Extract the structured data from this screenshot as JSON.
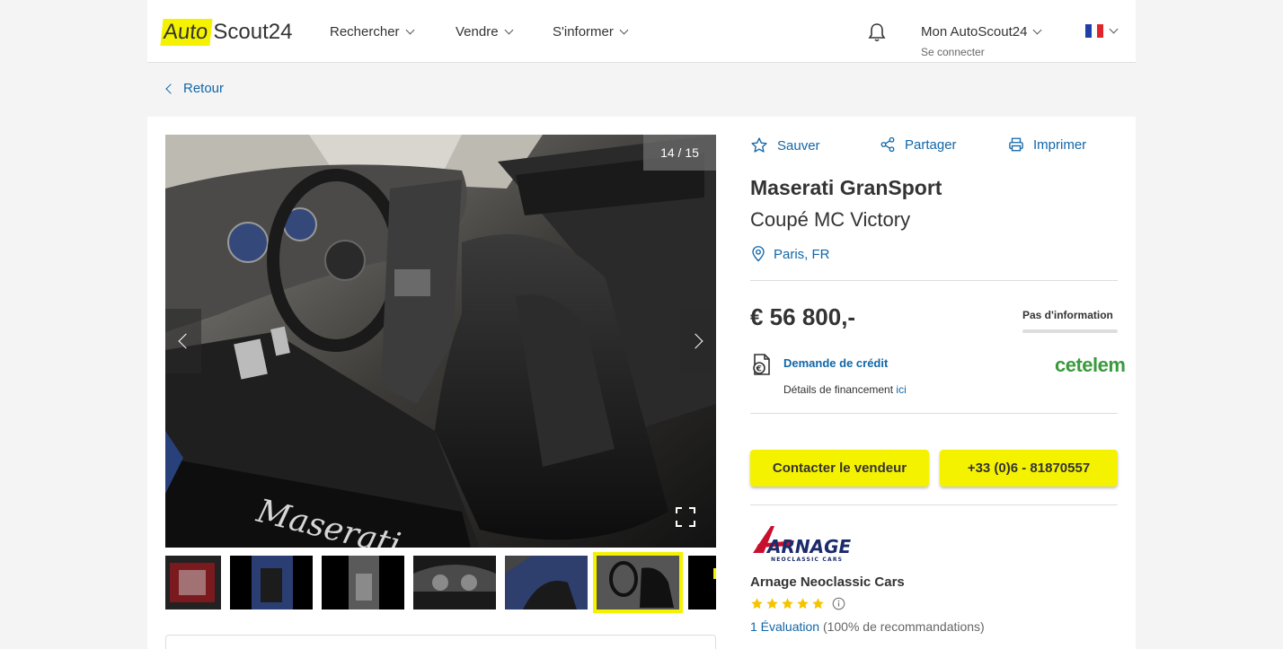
{
  "header": {
    "logo_auto": "Auto",
    "logo_scout": "Scout24",
    "nav": [
      {
        "label": "Rechercher"
      },
      {
        "label": "Vendre"
      },
      {
        "label": "S'informer"
      }
    ],
    "account_title": "Mon AutoScout24",
    "account_sub": "Se connecter",
    "language": "fr"
  },
  "back_label": "Retour",
  "gallery": {
    "counter": "14 / 15"
  },
  "actions": {
    "save": "Sauver",
    "share": "Partager",
    "print": "Imprimer"
  },
  "vehicle": {
    "make_model": "Maserati GranSport",
    "variant": "Coupé MC Victory",
    "location": "Paris, FR",
    "price": "€ 56 800,-",
    "price_rating": "Pas d'information"
  },
  "financing": {
    "link": "Demande de crédit",
    "details": "Détails de financement ",
    "details_link": "ici",
    "partner": "cetelem"
  },
  "buttons": {
    "contact": "Contacter le vendeur",
    "phone": "+33 (0)6 - 81870557"
  },
  "dealer": {
    "logo_text": "ARNAGE",
    "logo_sub": "NEOCLASSIC CARS",
    "name": "Arnage Neoclassic Cars",
    "rating": 5,
    "reviews_link": "1 Évaluation",
    "reviews_note": " (100% de recommandations)"
  },
  "colors": {
    "accent": "#f5f200",
    "link": "#1166a8",
    "star": "#f5c400",
    "cetelem": "#3a9a3c"
  }
}
